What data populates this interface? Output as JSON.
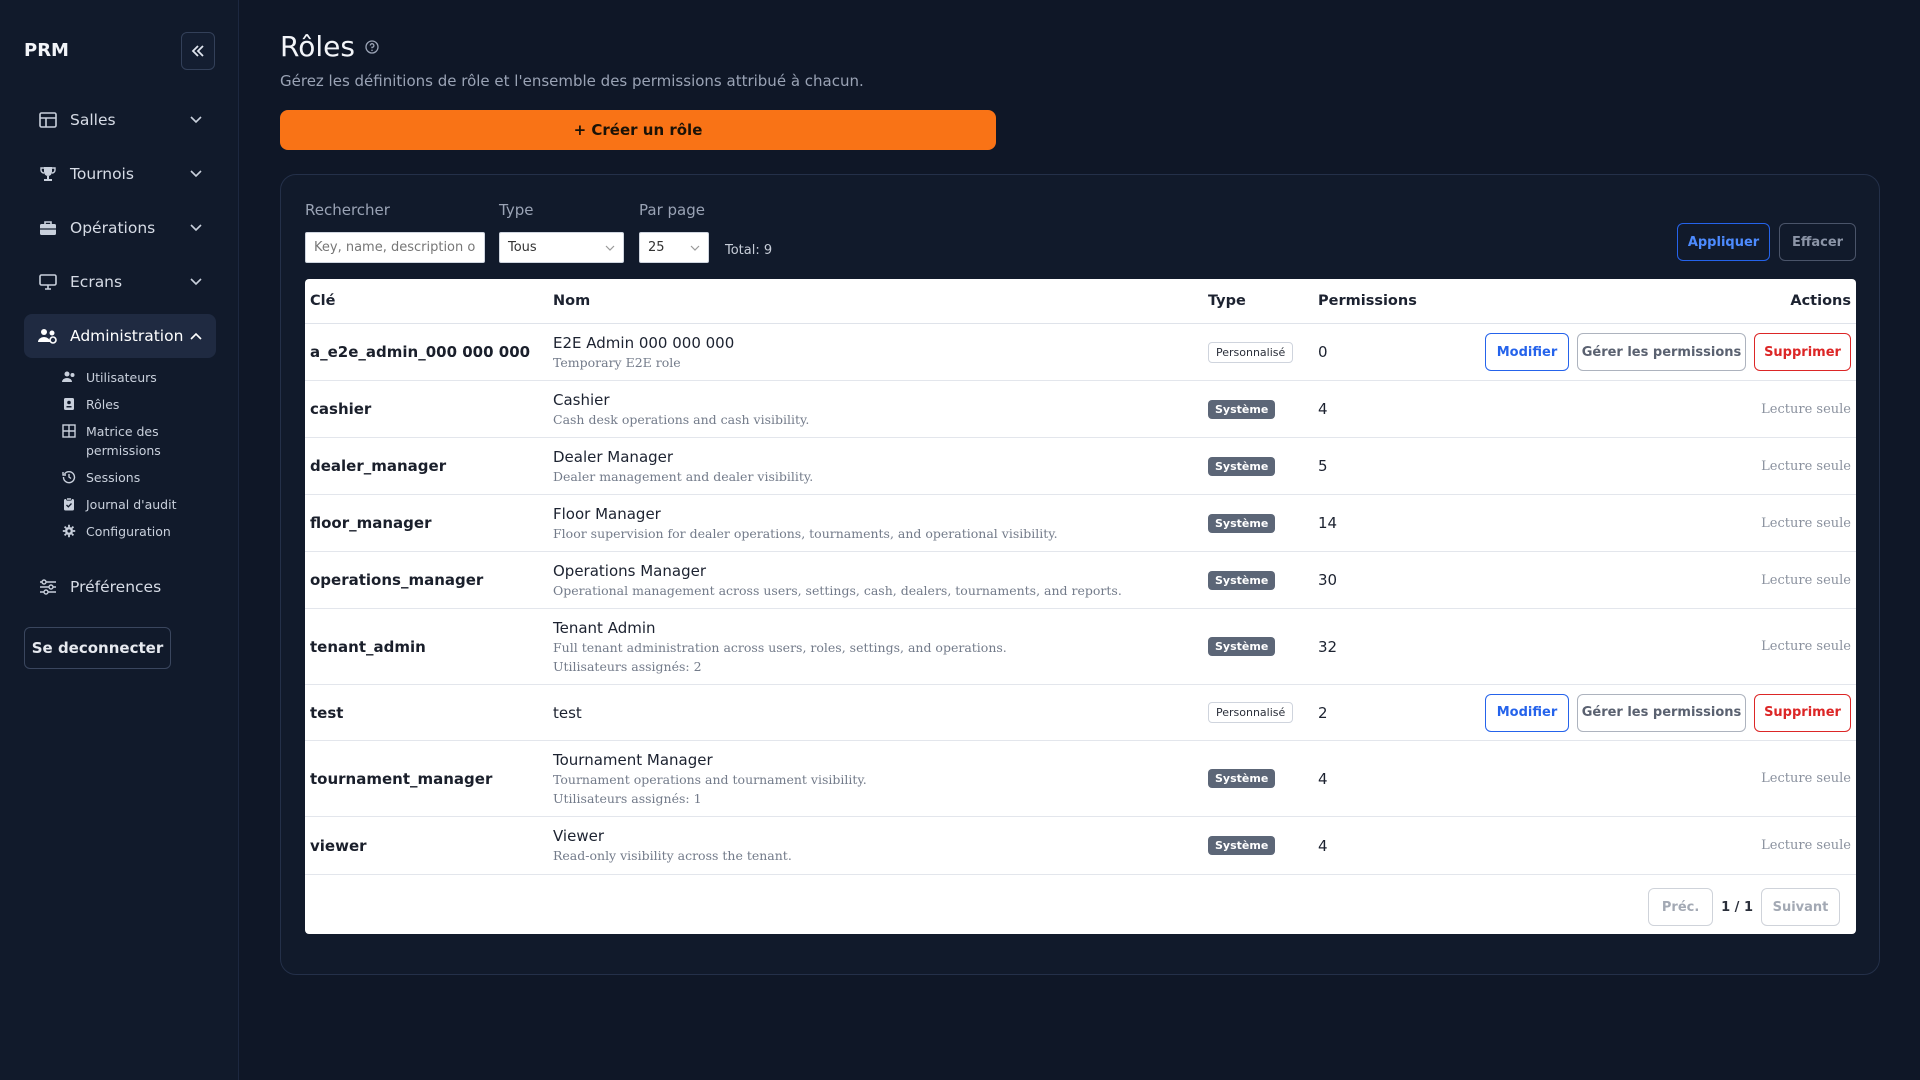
{
  "sidebar": {
    "brand": "PRM",
    "items": [
      {
        "label": "Salles",
        "icon": "table-icon"
      },
      {
        "label": "Tournois",
        "icon": "trophy-icon"
      },
      {
        "label": "Opérations",
        "icon": "briefcase-icon"
      },
      {
        "label": "Ecrans",
        "icon": "monitor-icon"
      },
      {
        "label": "Administration",
        "icon": "users-gear-icon"
      }
    ],
    "admin_sub": [
      {
        "label": "Utilisateurs",
        "icon": "users-icon"
      },
      {
        "label": "Rôles",
        "icon": "id-badge-icon"
      },
      {
        "label": "Matrice des permissions",
        "icon": "grid-icon"
      },
      {
        "label": "Sessions",
        "icon": "history-icon"
      },
      {
        "label": "Journal d'audit",
        "icon": "clipboard-icon"
      },
      {
        "label": "Configuration",
        "icon": "gear-icon"
      }
    ],
    "preferences": "Préférences",
    "logout": "Se deconnecter"
  },
  "header": {
    "title": "Rôles",
    "subtitle": "Gérez les définitions de rôle et l'ensemble des permissions attribué à chacun.",
    "create_label": "+ Créer un rôle"
  },
  "filters": {
    "search_label": "Rechercher",
    "search_placeholder": "Key, name, description or",
    "type_label": "Type",
    "type_value": "Tous",
    "perpage_label": "Par page",
    "perpage_value": "25",
    "total": "Total: 9",
    "apply": "Appliquer",
    "clear": "Effacer"
  },
  "table": {
    "headers": {
      "key": "Clé",
      "name": "Nom",
      "type": "Type",
      "permissions": "Permissions",
      "actions": "Actions"
    },
    "rows": [
      {
        "key": "a_e2e_admin_000 000 000",
        "name": "E2E Admin 000 000 000",
        "desc": "Temporary E2E role",
        "assigned": "",
        "type": "Personnalisé",
        "custom": true,
        "perms": "0"
      },
      {
        "key": "cashier",
        "name": "Cashier",
        "desc": "Cash desk operations and cash visibility.",
        "assigned": "",
        "type": "Système",
        "custom": false,
        "perms": "4"
      },
      {
        "key": "dealer_manager",
        "name": "Dealer Manager",
        "desc": "Dealer management and dealer visibility.",
        "assigned": "",
        "type": "Système",
        "custom": false,
        "perms": "5"
      },
      {
        "key": "floor_manager",
        "name": "Floor Manager",
        "desc": "Floor supervision for dealer operations, tournaments, and operational visibility.",
        "assigned": "",
        "type": "Système",
        "custom": false,
        "perms": "14"
      },
      {
        "key": "operations_manager",
        "name": "Operations Manager",
        "desc": "Operational management across users, settings, cash, dealers, tournaments, and reports.",
        "assigned": "",
        "type": "Système",
        "custom": false,
        "perms": "30"
      },
      {
        "key": "tenant_admin",
        "name": "Tenant Admin",
        "desc": "Full tenant administration across users, roles, settings, and operations.",
        "assigned": "Utilisateurs assignés: 2",
        "type": "Système",
        "custom": false,
        "perms": "32"
      },
      {
        "key": "test",
        "name": "test",
        "desc": "",
        "assigned": "",
        "type": "Personnalisé",
        "custom": true,
        "perms": "2"
      },
      {
        "key": "tournament_manager",
        "name": "Tournament Manager",
        "desc": "Tournament operations and tournament visibility.",
        "assigned": "Utilisateurs assignés: 1",
        "type": "Système",
        "custom": false,
        "perms": "4"
      },
      {
        "key": "viewer",
        "name": "Viewer",
        "desc": "Read-only visibility across the tenant.",
        "assigned": "",
        "type": "Système",
        "custom": false,
        "perms": "4"
      }
    ],
    "actions": {
      "edit": "Modifier",
      "manage": "Gérer les permissions",
      "delete": "Supprimer",
      "readonly": "Lecture seule"
    }
  },
  "pager": {
    "prev": "Préc.",
    "page": "1 / 1",
    "next": "Suivant"
  },
  "colors": {
    "accent": "#f97316",
    "primary": "#2563eb",
    "danger": "#dc2626",
    "background": "#0f1727"
  }
}
